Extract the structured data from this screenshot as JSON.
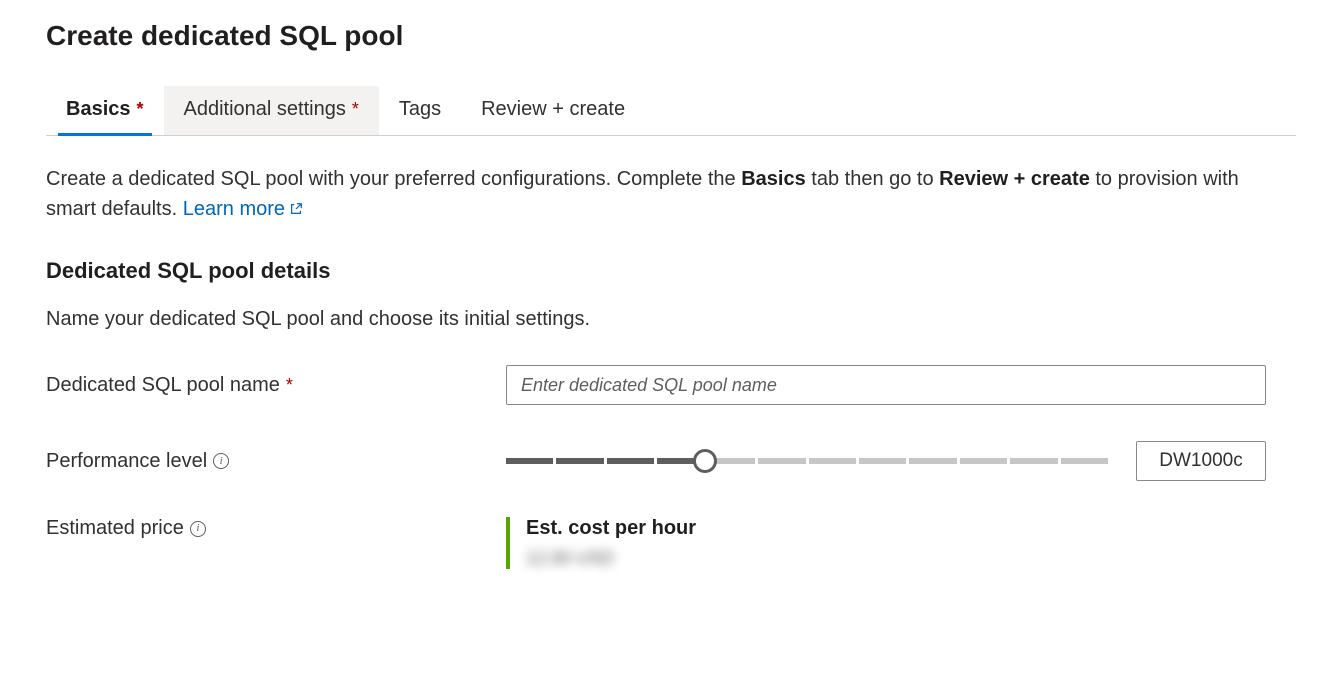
{
  "pageTitle": "Create dedicated SQL pool",
  "tabs": {
    "basics": "Basics",
    "additional": "Additional settings",
    "tags": "Tags",
    "review": "Review + create"
  },
  "intro": {
    "prefix": "Create a dedicated SQL pool with your preferred configurations. Complete the ",
    "bold1": "Basics",
    "mid": " tab then go to ",
    "bold2": "Review + create",
    "suffix": " to provision with smart defaults.",
    "learnMore": "Learn more"
  },
  "section": {
    "heading": "Dedicated SQL pool details",
    "desc": "Name your dedicated SQL pool and choose its initial settings."
  },
  "fields": {
    "poolNameLabel": "Dedicated SQL pool name",
    "poolNamePlaceholder": "Enter dedicated SQL pool name",
    "perfLabel": "Performance level",
    "perfValue": "DW1000c",
    "priceLabel": "Estimated price",
    "priceTitle": "Est. cost per hour",
    "priceValue": "12.00 USD"
  }
}
